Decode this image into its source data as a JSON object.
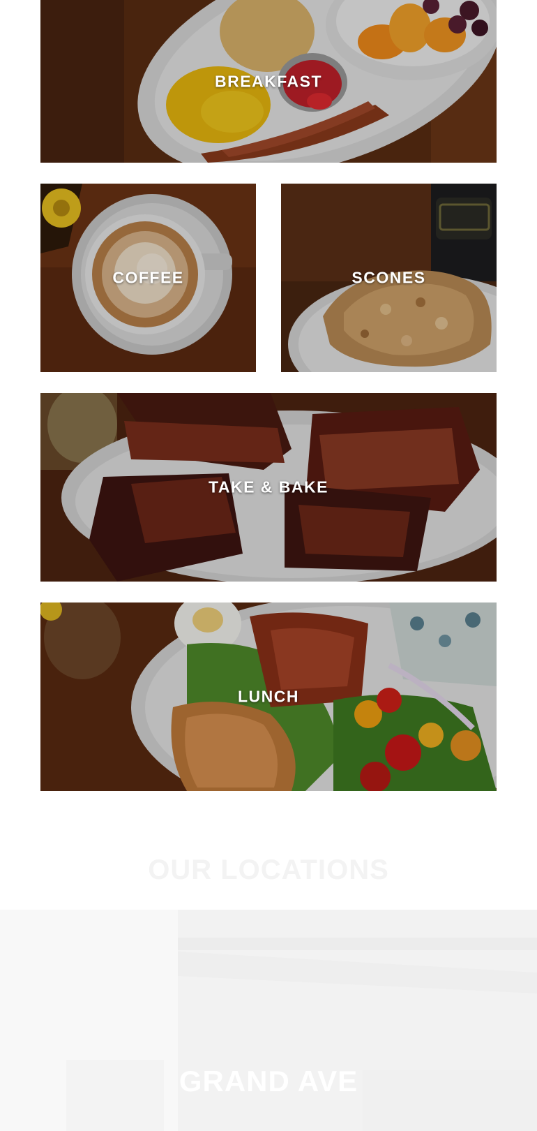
{
  "menu_categories": [
    {
      "label": "BREAKFAST"
    },
    {
      "label": "COFFEE"
    },
    {
      "label": "SCONES"
    },
    {
      "label": "TAKE & BAKE"
    },
    {
      "label": "LUNCH"
    }
  ],
  "locations": {
    "heading": "OUR LOCATIONS",
    "items": [
      {
        "name": "GRAND AVE"
      }
    ]
  },
  "colors": {
    "wood": "#6b3415",
    "plate": "#dcdcdc",
    "overlay_text": "#ffffff",
    "faded_band": "#f8f8f8"
  }
}
